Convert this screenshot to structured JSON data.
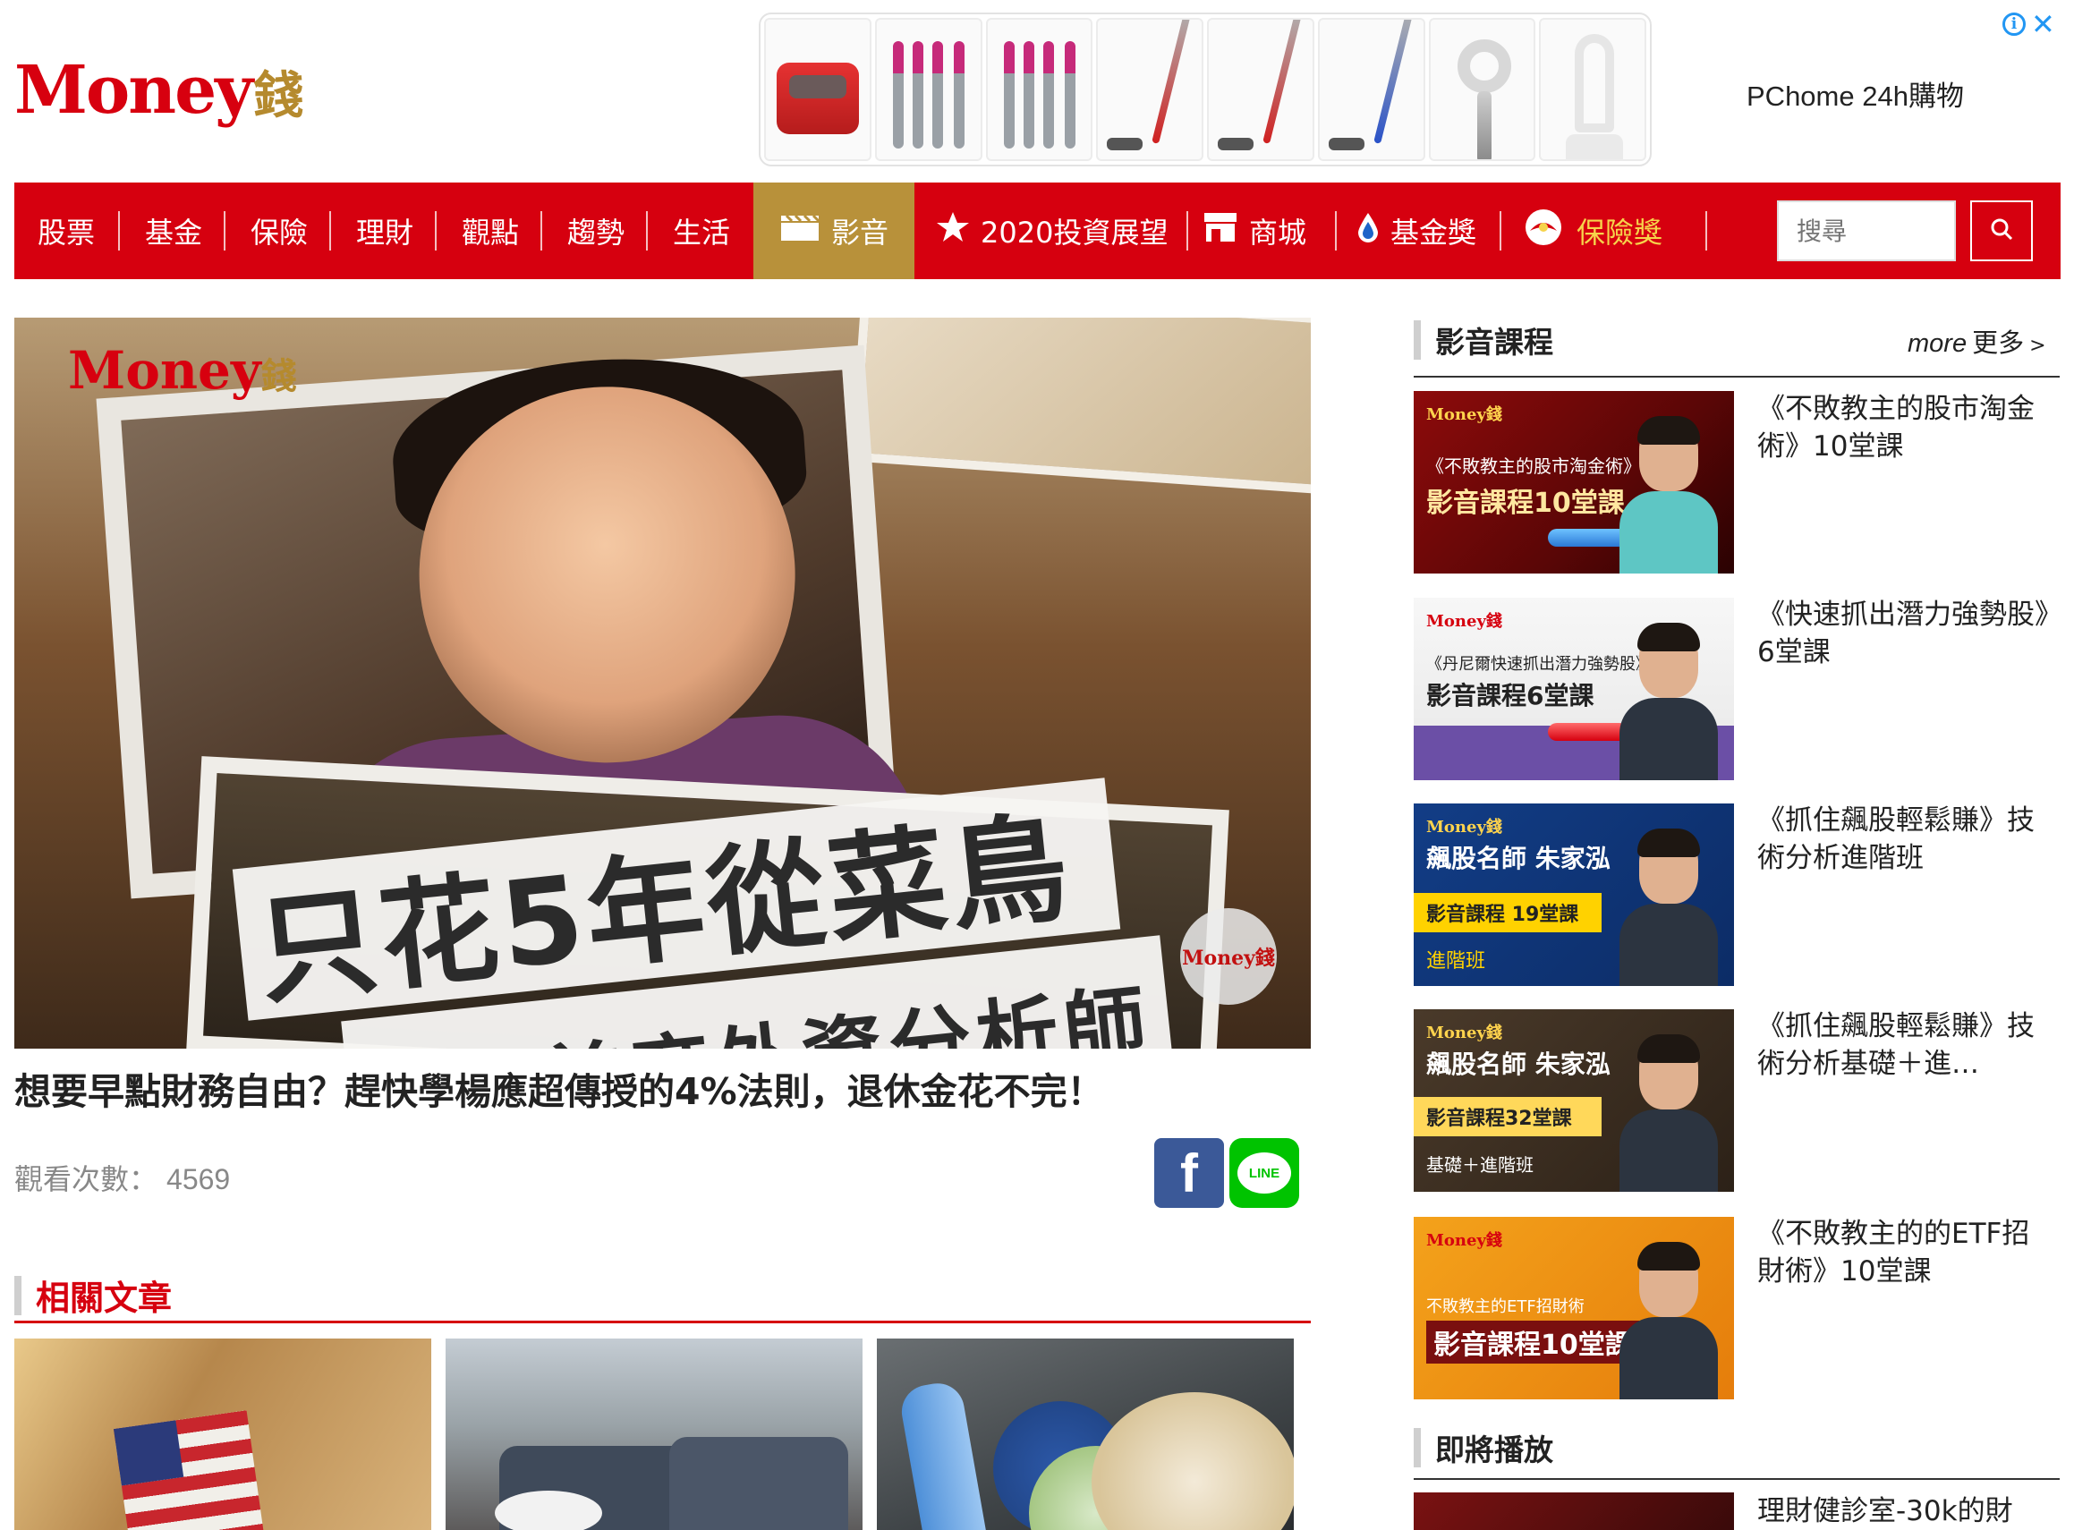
{
  "brand": {
    "logo_en": "Money",
    "logo_zh": "錢"
  },
  "ad": {
    "brand_text": "PChome 24h購物",
    "info_glyph": "i",
    "close_glyph": "✕"
  },
  "nav": {
    "items": [
      "股票",
      "基金",
      "保險",
      "理財",
      "觀點",
      "趨勢",
      "生活",
      "影音",
      "2020投資展望",
      "商城",
      "基金獎",
      "保險獎"
    ],
    "active_index": 7,
    "search_placeholder": "搜尋",
    "colors": {
      "bar": "#d6000f",
      "active": "#b8913a",
      "gold_text": "#f6d44b"
    }
  },
  "hero": {
    "overlay_line1": "只花5年從菜鳥",
    "overlay_line2": "晉升首席外資分析師",
    "logo_en": "Money",
    "logo_zh": "錢",
    "watermark": "Money錢"
  },
  "article": {
    "title": "想要早點財務自由？趕快學楊應超傳授的4%法則，退休金花不完！",
    "views_label": "觀看次數：",
    "views_value": "4569",
    "share": {
      "facebook": "f",
      "line": "LINE"
    }
  },
  "related": {
    "heading": "相關文章"
  },
  "sidebar": {
    "courses_heading": "影音課程",
    "more_en": "more",
    "more_zh": "更多",
    "more_arrow": ">",
    "courses": [
      {
        "title": "《不敗教主的股市淘金術》10堂課",
        "img_lines": [
          "《不敗教主的股市淘金術》",
          "影音課程10堂課"
        ],
        "img_tag": "Money錢"
      },
      {
        "title": "《快速抓出潛力強勢股》6堂課",
        "img_lines": [
          "《丹尼爾快速抓出潛力強勢股》",
          "影音課程6堂課"
        ],
        "img_tag": "Money錢"
      },
      {
        "title": "《抓住飆股輕鬆賺》技術分析進階班",
        "img_lines": [
          "飆股名師 朱家泓",
          "影音課程 19堂課",
          "進階班"
        ],
        "img_tag": "Money錢"
      },
      {
        "title": "《抓住飆股輕鬆賺》技術分析基礎＋進…",
        "img_lines": [
          "飆股名師 朱家泓",
          "影音課程32堂課",
          "基礎＋進階班"
        ],
        "img_tag": "Money錢"
      },
      {
        "title": "《不敗教主的的ETF招財術》10堂課",
        "img_lines": [
          "不敗教主的ETF招財術",
          "影音課程10堂課"
        ],
        "img_tag": "Money錢"
      }
    ],
    "upcoming_heading": "即將播放",
    "upcoming": [
      {
        "title": "理財健診室-30k的財"
      }
    ]
  }
}
